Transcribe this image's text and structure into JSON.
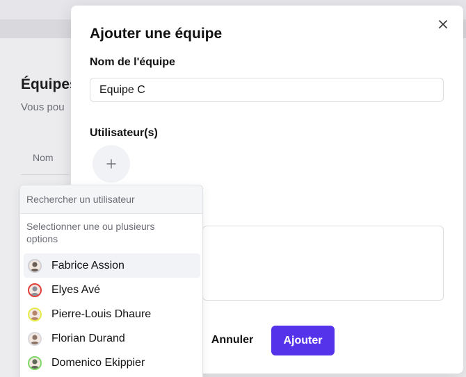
{
  "background": {
    "title": "Équipes",
    "subtitle": "Vous pou",
    "column_header": "Nom"
  },
  "modal": {
    "title": "Ajouter une équipe",
    "close_icon": "close-icon",
    "team_name_label": "Nom de l'équipe",
    "team_name_value": "Equipe C",
    "users_label": "Utilisateur(s)",
    "add_user_icon": "plus-icon",
    "cancel_label": "Annuler",
    "submit_label": "Ajouter",
    "accent_color": "#5533eb"
  },
  "dropdown": {
    "search_placeholder": "Rechercher un utilisateur",
    "hint": "Selectionner une ou plusieurs options",
    "users": [
      {
        "name": "Fabrice Assion",
        "avatar_ring": "#cfcfd4",
        "avatar_fill": "#6b5e55",
        "highlighted": true
      },
      {
        "name": "Elyes Avé",
        "avatar_ring": "#e0403a",
        "avatar_fill": "#8a8f99",
        "highlighted": false
      },
      {
        "name": "Pierre-Louis Dhaure",
        "avatar_ring": "#e6ec4a",
        "avatar_fill": "#b5846a",
        "highlighted": false
      },
      {
        "name": "Florian Durand",
        "avatar_ring": "#d9d9de",
        "avatar_fill": "#8c7567",
        "highlighted": false
      },
      {
        "name": "Domenico Ekippier",
        "avatar_ring": "#7fd86a",
        "avatar_fill": "#5d6a55",
        "highlighted": false
      }
    ]
  }
}
